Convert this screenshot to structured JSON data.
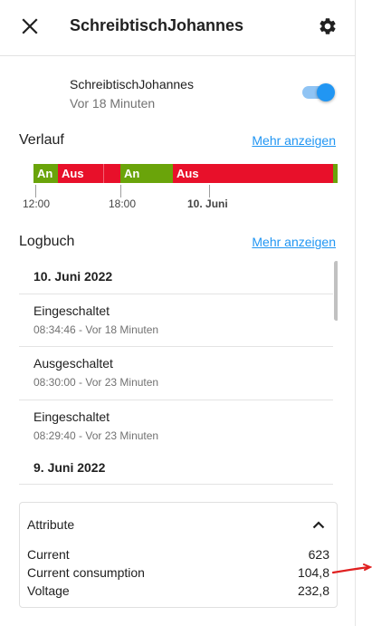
{
  "header": {
    "title": "SchreibtischJohannes",
    "close_icon": "close-icon",
    "settings_icon": "gear-icon"
  },
  "entity": {
    "name": "SchreibtischJohannes",
    "last_changed": "Vor 18 Minuten",
    "toggle_state": "on",
    "toggle_color": "#2196f3"
  },
  "history": {
    "title": "Verlauf",
    "more_link": "Mehr anzeigen",
    "segments": [
      {
        "label": "An",
        "state": "on",
        "color": "#6aa40a"
      },
      {
        "label": "Aus",
        "state": "off",
        "color": "#e8102a"
      },
      {
        "label": "",
        "state": "off",
        "color": "#e8102a"
      },
      {
        "label": "An",
        "state": "on",
        "color": "#6aa40a"
      },
      {
        "label": "Aus",
        "state": "off",
        "color": "#e8102a"
      },
      {
        "label": "",
        "state": "on",
        "color": "#6aa40a"
      }
    ],
    "ticks": [
      "12:00",
      "18:00",
      "10. Juni"
    ]
  },
  "logbook": {
    "title": "Logbuch",
    "more_link": "Mehr anzeigen",
    "date1": "10. Juni 2022",
    "entries": [
      {
        "title": "Eingeschaltet",
        "subtitle": "08:34:46 - Vor 18 Minuten"
      },
      {
        "title": "Ausgeschaltet",
        "subtitle": "08:30:00 - Vor 23 Minuten"
      },
      {
        "title": "Eingeschaltet",
        "subtitle": "08:29:40 - Vor 23 Minuten"
      }
    ],
    "date2": "9. Juni 2022"
  },
  "attributes": {
    "title": "Attribute",
    "expanded": true,
    "rows": [
      {
        "name": "Current",
        "value": "623"
      },
      {
        "name": "Current consumption",
        "value": "104,8"
      },
      {
        "name": "Voltage",
        "value": "232,8"
      }
    ]
  },
  "annotation_color": "#e02020"
}
